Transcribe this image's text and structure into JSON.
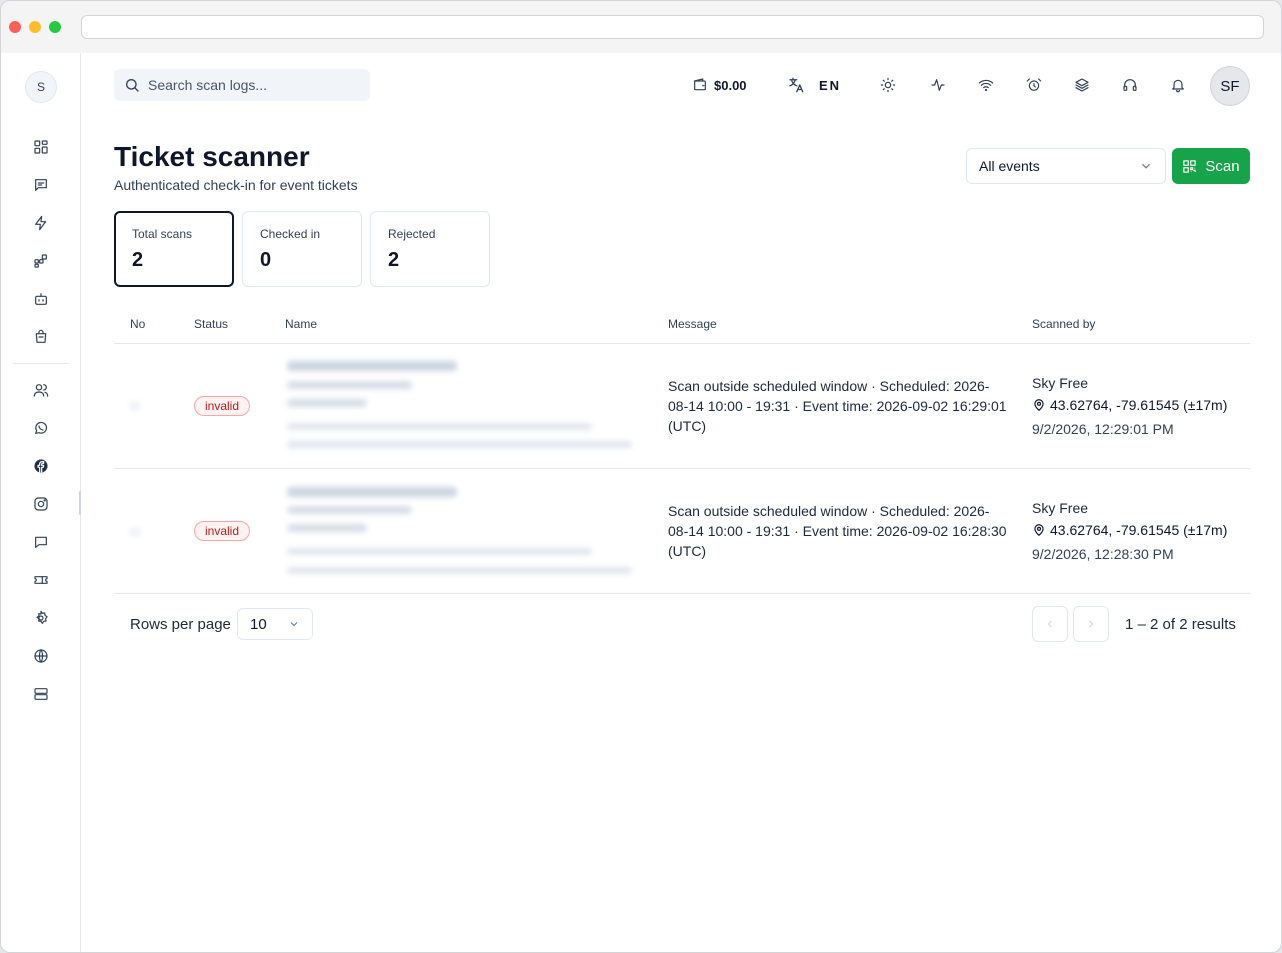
{
  "search": {
    "placeholder": "Search scan logs..."
  },
  "topbar": {
    "balance": "$0.00",
    "language": "EN",
    "user_initials": "SF",
    "icons": [
      "wallet-icon",
      "translate-icon",
      "sun-icon",
      "activity-icon",
      "wifi-icon",
      "alarm-icon",
      "layers-icon",
      "headset-icon",
      "bell-icon"
    ]
  },
  "sidebar": {
    "workspace_initial": "S",
    "items": [
      "dashboard-icon",
      "messages-icon",
      "bolt-icon",
      "apps-icon",
      "bot-icon",
      "inbox-icon",
      "users-icon",
      "whatsapp-icon",
      "facebook-icon",
      "instagram-icon",
      "chat-icon",
      "ticket-icon",
      "settings-icon",
      "globe-icon",
      "server-icon"
    ]
  },
  "page": {
    "title": "Ticket scanner",
    "subtitle": "Authenticated check-in for event tickets"
  },
  "filter": {
    "selected": "All events"
  },
  "scan_button": "Scan",
  "stats": [
    {
      "label": "Total scans",
      "value": "2"
    },
    {
      "label": "Checked in",
      "value": "0"
    },
    {
      "label": "Rejected",
      "value": "2"
    }
  ],
  "table": {
    "headers": {
      "no": "No",
      "status": "Status",
      "name": "Name",
      "message": "Message",
      "scanned_by": "Scanned by"
    },
    "rows": [
      {
        "status": "invalid",
        "message": "Scan outside scheduled window · Scheduled: 2026-08-14 10:00 - 19:31 · Event time: 2026-09-02 16:29:01 (UTC)",
        "scanner": "Sky Free",
        "location": "43.62764, -79.61545 (±17m)",
        "time": "9/2/2026, 12:29:01 PM"
      },
      {
        "status": "invalid",
        "message": "Scan outside scheduled window · Scheduled: 2026-08-14 10:00 - 19:31 · Event time: 2026-09-02 16:28:30 (UTC)",
        "scanner": "Sky Free",
        "location": "43.62764, -79.61545 (±17m)",
        "time": "9/2/2026, 12:28:30 PM"
      }
    ]
  },
  "pagination": {
    "rows_per_page_label": "Rows per page",
    "rows_per_page": "10",
    "summary": "1 – 2 of 2 results"
  },
  "colors": {
    "accent": "#16a34a",
    "invalid_text": "#b91c1c",
    "invalid_bg": "#fef2f2"
  }
}
